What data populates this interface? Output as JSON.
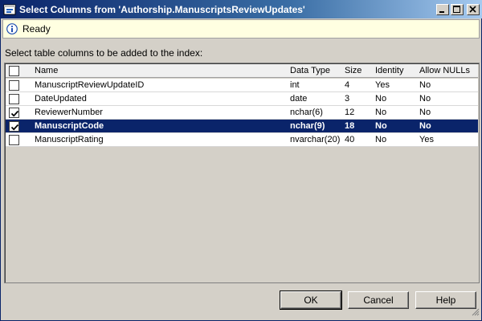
{
  "window": {
    "title": "Select Columns from 'Authorship.ManuscriptsReviewUpdates'"
  },
  "status": {
    "text": "Ready",
    "icon": "info-icon"
  },
  "prompt": "Select table columns to be added to the index:",
  "grid": {
    "headers": {
      "name": "Name",
      "data_type": "Data Type",
      "size": "Size",
      "identity": "Identity",
      "allow_nulls": "Allow NULLs"
    },
    "rows": [
      {
        "checked": false,
        "selected": false,
        "name": "ManuscriptReviewUpdateID",
        "data_type": "int",
        "size": "4",
        "identity": "Yes",
        "allow_nulls": "No"
      },
      {
        "checked": false,
        "selected": false,
        "name": "DateUpdated",
        "data_type": "date",
        "size": "3",
        "identity": "No",
        "allow_nulls": "No"
      },
      {
        "checked": true,
        "selected": false,
        "name": "ReviewerNumber",
        "data_type": "nchar(6)",
        "size": "12",
        "identity": "No",
        "allow_nulls": "No"
      },
      {
        "checked": true,
        "selected": true,
        "name": "ManuscriptCode",
        "data_type": "nchar(9)",
        "size": "18",
        "identity": "No",
        "allow_nulls": "No"
      },
      {
        "checked": false,
        "selected": false,
        "name": "ManuscriptRating",
        "data_type": "nvarchar(20)",
        "size": "40",
        "identity": "No",
        "allow_nulls": "Yes"
      }
    ]
  },
  "buttons": {
    "ok": "OK",
    "cancel": "Cancel",
    "help": "Help"
  },
  "colors": {
    "selection": "#0a246a",
    "dialog_bg": "#d4d0c8",
    "status_bg": "#ffffe1"
  }
}
